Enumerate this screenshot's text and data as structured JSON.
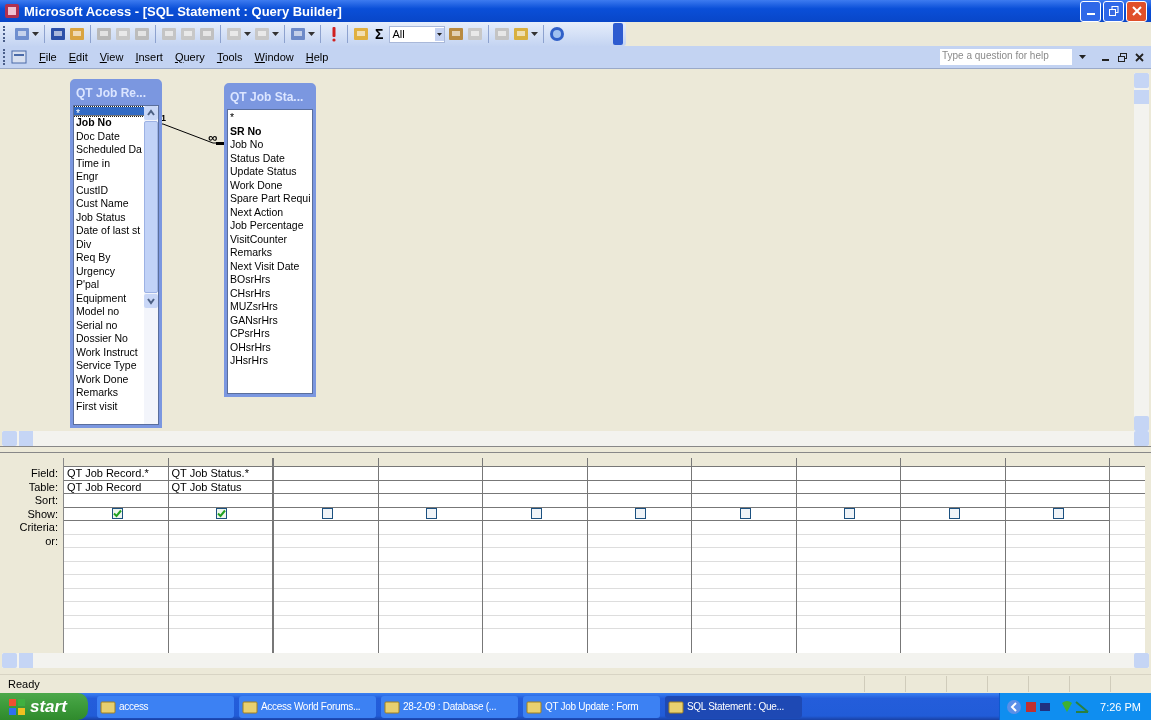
{
  "window": {
    "title": "Microsoft Access - [SQL Statement : Query Builder]"
  },
  "toolbar": {
    "sigma": "Σ",
    "combo_value": "All"
  },
  "menu": [
    "File",
    "Edit",
    "View",
    "Insert",
    "Query",
    "Tools",
    "Window",
    "Help"
  ],
  "help_box": {
    "placeholder": "Type a question for help"
  },
  "tables": [
    {
      "title": "QT Job Re...",
      "fields": [
        {
          "name": "*",
          "key": false,
          "selected": true
        },
        {
          "name": "Job No",
          "key": true,
          "selected": false
        },
        {
          "name": "Doc Date",
          "key": false,
          "selected": false
        },
        {
          "name": "Scheduled Da",
          "key": false,
          "selected": false
        },
        {
          "name": "Time in",
          "key": false,
          "selected": false
        },
        {
          "name": "Engr",
          "key": false,
          "selected": false
        },
        {
          "name": "CustID",
          "key": false,
          "selected": false
        },
        {
          "name": "Cust Name",
          "key": false,
          "selected": false
        },
        {
          "name": "Job Status",
          "key": false,
          "selected": false
        },
        {
          "name": "Date of last st",
          "key": false,
          "selected": false
        },
        {
          "name": "Div",
          "key": false,
          "selected": false
        },
        {
          "name": "Req By",
          "key": false,
          "selected": false
        },
        {
          "name": "Urgency",
          "key": false,
          "selected": false
        },
        {
          "name": "P'pal",
          "key": false,
          "selected": false
        },
        {
          "name": "Equipment",
          "key": false,
          "selected": false
        },
        {
          "name": "Model no",
          "key": false,
          "selected": false
        },
        {
          "name": "Serial no",
          "key": false,
          "selected": false
        },
        {
          "name": "Dossier No",
          "key": false,
          "selected": false
        },
        {
          "name": "Work Instruct",
          "key": false,
          "selected": false
        },
        {
          "name": "Service Type",
          "key": false,
          "selected": false
        },
        {
          "name": "Work Done",
          "key": false,
          "selected": false
        },
        {
          "name": "Remarks",
          "key": false,
          "selected": false
        },
        {
          "name": "First visit",
          "key": false,
          "selected": false
        }
      ]
    },
    {
      "title": "QT Job Sta...",
      "fields": [
        {
          "name": "*",
          "key": false,
          "selected": false
        },
        {
          "name": "SR No",
          "key": true,
          "selected": false
        },
        {
          "name": "Job No",
          "key": false,
          "selected": false
        },
        {
          "name": "Status Date",
          "key": false,
          "selected": false
        },
        {
          "name": "Update Status",
          "key": false,
          "selected": false
        },
        {
          "name": "Work Done",
          "key": false,
          "selected": false
        },
        {
          "name": "Spare Part Requi",
          "key": false,
          "selected": false
        },
        {
          "name": "Next Action",
          "key": false,
          "selected": false
        },
        {
          "name": "Job Percentage",
          "key": false,
          "selected": false
        },
        {
          "name": "VisitCounter",
          "key": false,
          "selected": false
        },
        {
          "name": "Remarks",
          "key": false,
          "selected": false
        },
        {
          "name": "Next Visit Date",
          "key": false,
          "selected": false
        },
        {
          "name": "BOsrHrs",
          "key": false,
          "selected": false
        },
        {
          "name": "CHsrHrs",
          "key": false,
          "selected": false
        },
        {
          "name": "MUZsrHrs",
          "key": false,
          "selected": false
        },
        {
          "name": "GANsrHrs",
          "key": false,
          "selected": false
        },
        {
          "name": "CPsrHrs",
          "key": false,
          "selected": false
        },
        {
          "name": "OHsrHrs",
          "key": false,
          "selected": false
        },
        {
          "name": "JHsrHrs",
          "key": false,
          "selected": false
        }
      ]
    }
  ],
  "join": {
    "one": "1",
    "many": "∞"
  },
  "grid": {
    "row_labels": [
      "Field:",
      "Table:",
      "Sort:",
      "Show:",
      "Criteria:",
      "or:"
    ],
    "columns": [
      {
        "field": "QT Job Record.*",
        "table": "QT Job Record",
        "show": true
      },
      {
        "field": "QT Job Status.*",
        "table": "QT Job Status",
        "show": true
      },
      {
        "show": false
      },
      {
        "show": false
      },
      {
        "show": false
      },
      {
        "show": false
      },
      {
        "show": false
      },
      {
        "show": false
      },
      {
        "show": false
      },
      {
        "show": false
      }
    ]
  },
  "status_bar": {
    "text": "Ready"
  },
  "taskbar": {
    "start": "start",
    "tasks": [
      {
        "label": "access",
        "selected": false
      },
      {
        "label": "Access World Forums...",
        "selected": false
      },
      {
        "label": "28-2-09 : Database (...",
        "selected": false
      },
      {
        "label": "QT Job Update : Form",
        "selected": false
      },
      {
        "label": "SQL Statement : Que...",
        "selected": true
      }
    ],
    "clock": "7:26 PM"
  }
}
